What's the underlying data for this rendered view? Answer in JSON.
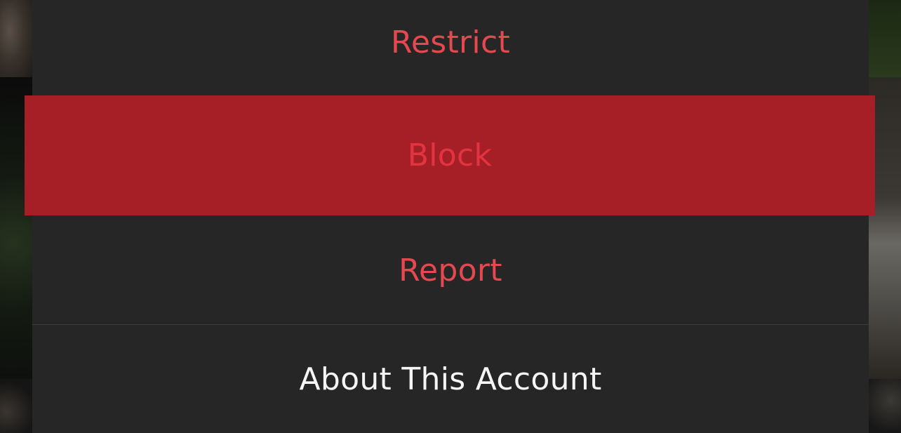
{
  "action_sheet": {
    "restrict_label": "Restrict",
    "block_label": "Block",
    "report_label": "Report",
    "about_label": "About This Account"
  },
  "colors": {
    "destructive_text": "#e5484f",
    "normal_text": "#f5f5f5",
    "sheet_background": "#262626",
    "highlight_background": "#a71f26"
  }
}
